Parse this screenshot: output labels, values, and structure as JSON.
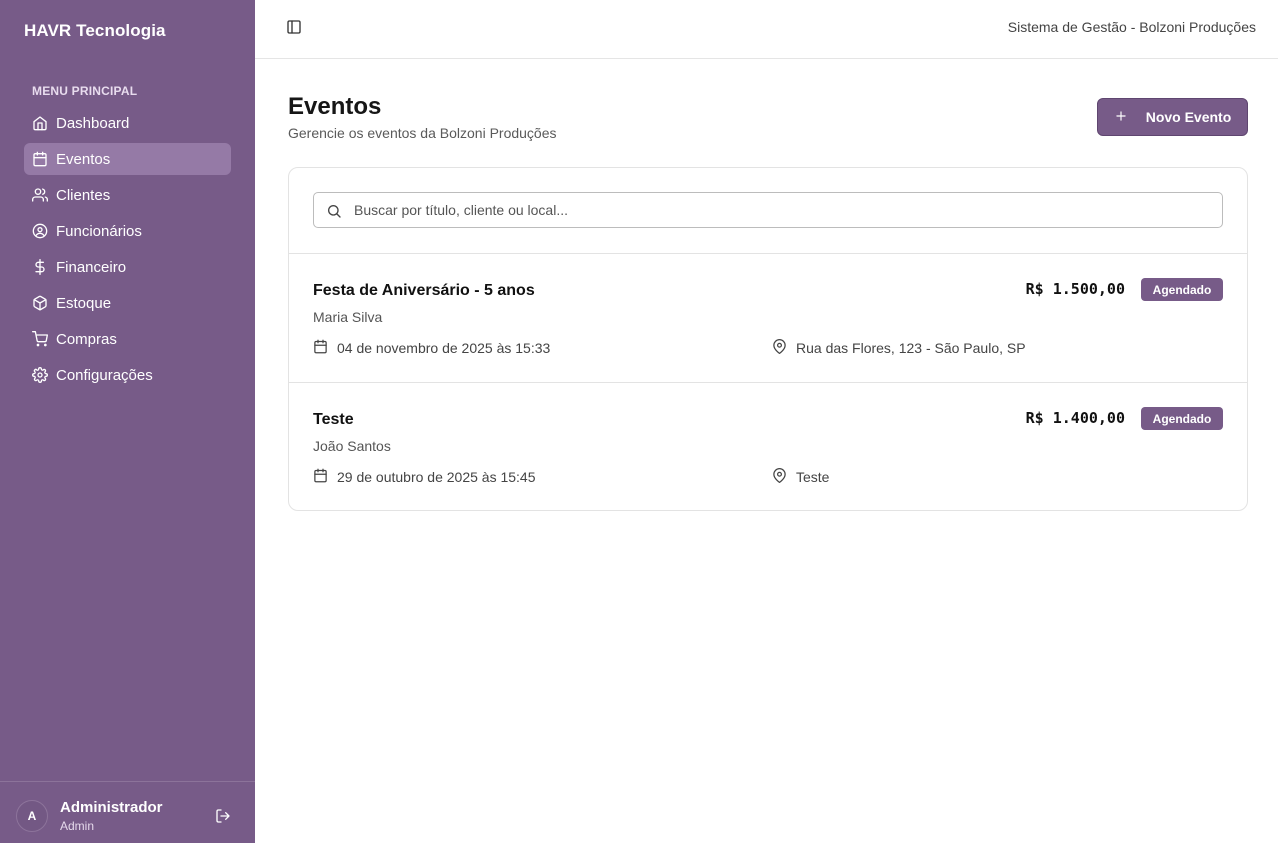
{
  "sidebar": {
    "brand": "HAVR Tecnologia",
    "menu_heading": "MENU PRINCIPAL",
    "items": [
      {
        "label": "Dashboard",
        "icon": "home-icon"
      },
      {
        "label": "Eventos",
        "icon": "calendar-icon",
        "active": true
      },
      {
        "label": "Clientes",
        "icon": "users-icon"
      },
      {
        "label": "Funcionários",
        "icon": "user-circle-icon"
      },
      {
        "label": "Financeiro",
        "icon": "dollar-icon"
      },
      {
        "label": "Estoque",
        "icon": "package-icon"
      },
      {
        "label": "Compras",
        "icon": "cart-icon"
      },
      {
        "label": "Configurações",
        "icon": "gear-icon"
      }
    ],
    "user": {
      "initial": "A",
      "name": "Administrador",
      "role": "Admin"
    }
  },
  "header": {
    "title": "Sistema de Gestão - Bolzoni Produções"
  },
  "main": {
    "title": "Eventos",
    "subtitle": "Gerencie os eventos da Bolzoni Produções",
    "new_button_label": "Novo Evento",
    "search": {
      "placeholder": "Buscar por título, cliente ou local...",
      "value": ""
    },
    "events": [
      {
        "title": "Festa de Aniversário - 5 anos",
        "client": "Maria Silva",
        "date": "04 de novembro de 2025 às 15:33",
        "location": "Rua das Flores, 123 - São Paulo, SP",
        "price": "R$ 1.500,00",
        "status": "Agendado"
      },
      {
        "title": "Teste",
        "client": "João Santos",
        "date": "29 de outubro de 2025 às 15:45",
        "location": "Teste",
        "price": "R$ 1.400,00",
        "status": "Agendado"
      }
    ]
  },
  "colors": {
    "accent": "#775b88",
    "active_item": "#957aa6"
  }
}
